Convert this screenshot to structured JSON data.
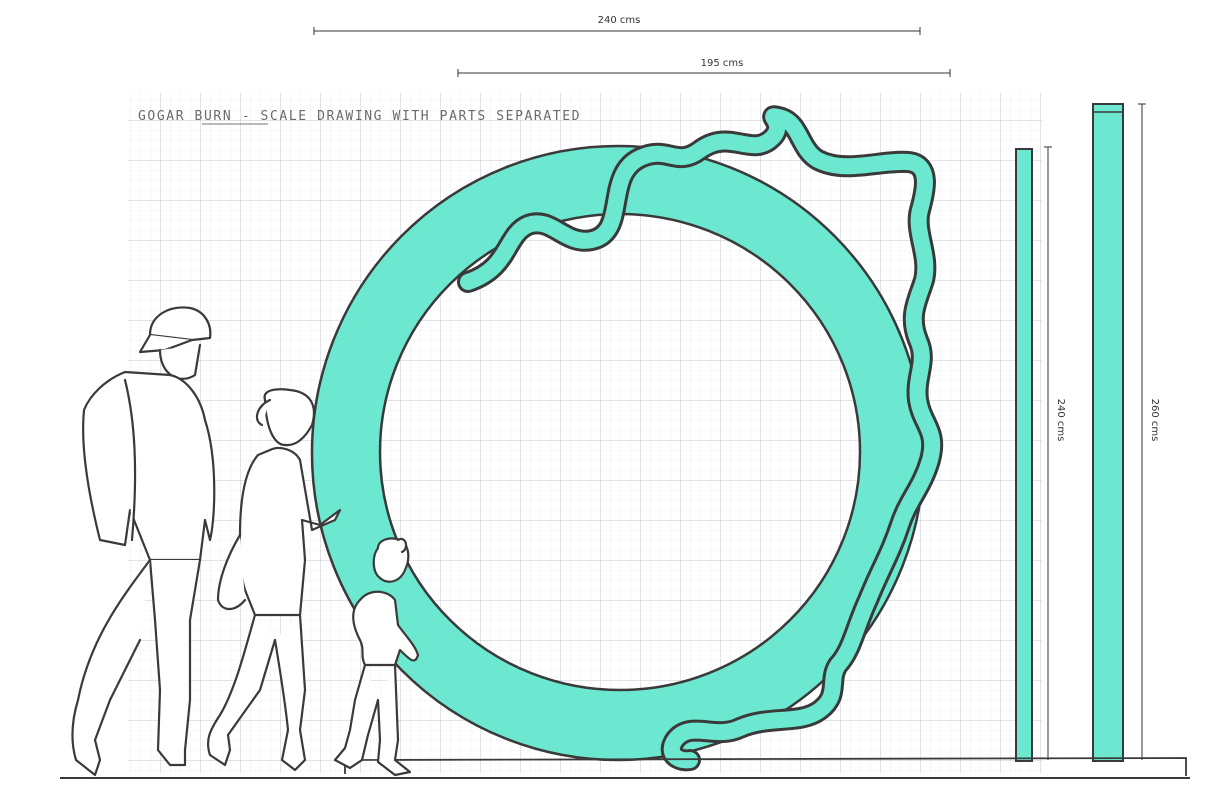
{
  "title": "GOGAR BURN - SCALE DRAWING WITH PARTS SEPARATED",
  "dimensions": {
    "overall_width": "240 cms",
    "ring_width": "195 cms",
    "bar1_height": "240 cms",
    "bar2_height": "260 cms"
  },
  "colors": {
    "teal": "#6de8d0",
    "ink": "#3a3a3a",
    "grid_minor": "#e3e3ea",
    "grid_major": "#c6c6d0",
    "paper": "#ffffff"
  },
  "figures": [
    "man-with-cap",
    "woman-with-phone",
    "child"
  ]
}
